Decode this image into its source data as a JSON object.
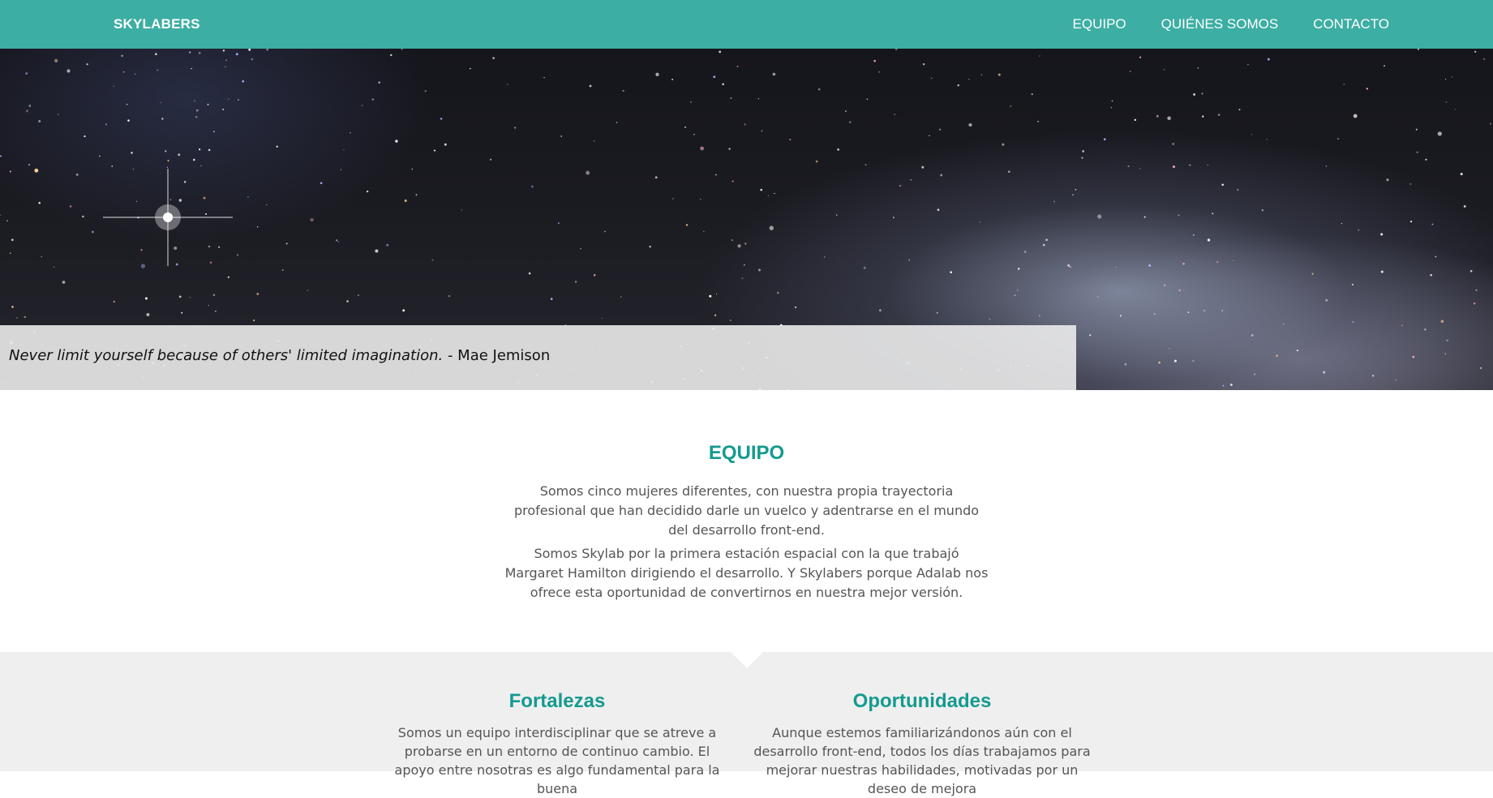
{
  "nav": {
    "brand": "SKYLABERS",
    "links": [
      "EQUIPO",
      "QUIÉNES SOMOS",
      "CONTACTO"
    ]
  },
  "hero": {
    "quote": "Never limit yourself because of others' limited imagination.",
    "author": " - Mae Jemison"
  },
  "team": {
    "title": "EQUIPO",
    "paragraph1": "Somos cinco mujeres diferentes, con nuestra propia trayectoria profesional que han decidido darle un vuelco y adentrarse en el mundo del desarrollo front-end.",
    "paragraph2": "Somos Skylab por la primera estación espacial con la que trabajó Margaret Hamilton dirigiendo el desarrollo. Y Skylabers porque Adalab nos ofrece esta oportunidad de convertirnos en nuestra mejor versión."
  },
  "swot": {
    "strengths": {
      "title": "Fortalezas",
      "text": "Somos un equipo interdisciplinar que se atreve a probarse en un entorno de continuo cambio. El apoyo entre nosotras es algo fundamental para la buena"
    },
    "opportunities": {
      "title": "Oportunidades",
      "text": "Aunque estemos familiarizándonos aún con el desarrollo front-end, todos los días trabajamos para mejorar nuestras habilidades, motivadas por un deseo de mejora"
    }
  },
  "colors": {
    "navbar": "#3caea3",
    "accent": "#159a8f",
    "swot_background": "#efefef",
    "body_text": "#555555"
  }
}
